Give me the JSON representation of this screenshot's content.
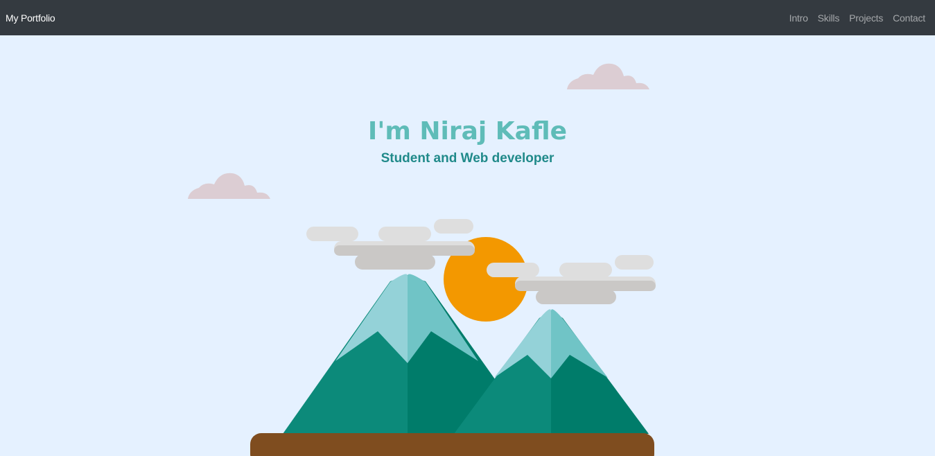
{
  "navbar": {
    "brand": "My Portfolio",
    "links": [
      "Intro",
      "Skills",
      "Projects",
      "Contact"
    ]
  },
  "hero": {
    "title": "I'm Niraj Kafle",
    "subtitle": "Student and Web developer"
  },
  "colors": {
    "navbar_bg": "#343a40",
    "page_bg": "#e5f1ff",
    "title": "#5fbcb8",
    "subtitle": "#208a8a",
    "sun": "#f39800",
    "ground": "#7f4d1f",
    "mountain_dark": "#007c6a",
    "mountain_light": "#0c8a7a",
    "snow_light": "#94d2d8",
    "snow_dark": "#70c4c6",
    "cloud_light": "#dedede",
    "cloud_dark": "#cac8c6",
    "pink_cloud": "#dccdd3"
  }
}
